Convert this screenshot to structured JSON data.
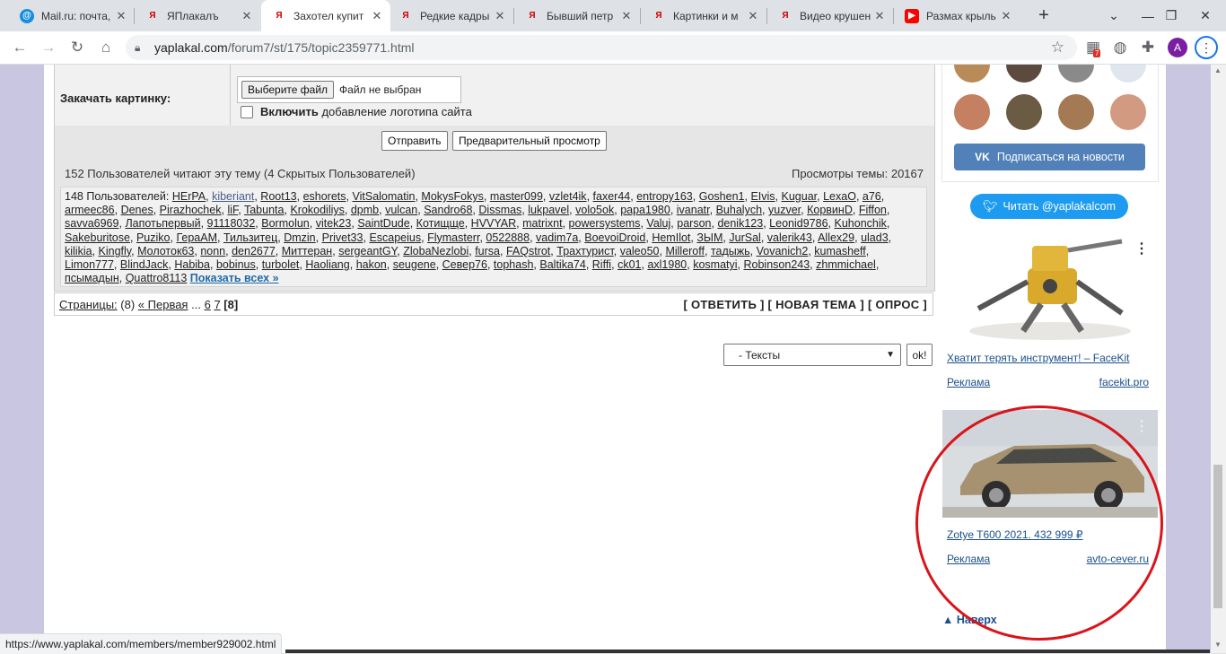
{
  "tabs": [
    {
      "title": "Mail.ru: почта,",
      "fav": "@",
      "kind": "mail"
    },
    {
      "title": "ЯПлакалъ",
      "fav": "Я",
      "kind": "yp"
    },
    {
      "title": "Захотел купит",
      "fav": "Я",
      "kind": "yp",
      "active": true
    },
    {
      "title": "Редкие кадры",
      "fav": "Я",
      "kind": "yp"
    },
    {
      "title": "Бывший петр",
      "fav": "Я",
      "kind": "yp"
    },
    {
      "title": "Картинки и м",
      "fav": "Я",
      "kind": "yp"
    },
    {
      "title": "Видео крушен",
      "fav": "Я",
      "kind": "yp"
    },
    {
      "title": "Размах крыль",
      "fav": "▶",
      "kind": "yt"
    }
  ],
  "toolbar": {
    "url_host": "yaplakal.com",
    "url_path": "/forum7/st/175/topic2359771.html",
    "avatar_letter": "A",
    "ext_badge": "7"
  },
  "form": {
    "upload_label": "Закачать картинку:",
    "file_button": "Выберите файл",
    "file_status": "Файл не выбран",
    "logo_bold": "Включить",
    "logo_rest": "добавление логотипа сайта",
    "submit": "Отправить",
    "preview": "Предварительный просмотр"
  },
  "readers": {
    "summary": "152 Пользователей читают эту тему (4 Скрытых Пользователей)",
    "views": "Просмотры темы: 20167",
    "users_prefix": "148 Пользователей:",
    "users": [
      "HErPA",
      "kiberiant",
      "Root13",
      "eshorets",
      "VitSalomatin",
      "MokysFokys",
      "master099",
      "vzlet4ik",
      "faxer44",
      "entropy163",
      "Goshen1",
      "EIvis",
      "Kuguar",
      "LexaO",
      "a76",
      "armeec86",
      "Denes",
      "Pirazhochek",
      "liF",
      "Tabunta",
      "Krokodiliys",
      "dpmb",
      "vulcan",
      "Sandro68",
      "Dissmas",
      "lukpavel",
      "volo5ok",
      "papa1980",
      "ivanatr",
      "Buhalych",
      "yuzver",
      "КорвинD",
      "Fiffon",
      "savva6969",
      "Лапотьпервый",
      "91118032",
      "Bormolun",
      "vitek23",
      "SaintDude",
      "Котищще",
      "HVVYAR",
      "matrixnt",
      "powersystems",
      "Valuj",
      "parson",
      "denik123",
      "Leonid9786",
      "Kuhonchik",
      "Sakeburitose",
      "Puziko",
      "ГераАМ",
      "Тильзитец",
      "Dmzin",
      "Privet33",
      "Escapeius",
      "Flymasterr",
      "0522888",
      "vadim7a",
      "BoevoiDroid",
      "HemIlot",
      "ЗЫМ",
      "JurSal",
      "valerik43",
      "Allex29",
      "ulad3",
      "kilikia",
      "Kingfly",
      "Молоток63",
      "nonn",
      "den2677",
      "Миттеран",
      "sergeantGY",
      "ZlobaNezlobi",
      "fursa",
      "FAQstrot",
      "Трахтурист",
      "valeo50",
      "Milleroff",
      "тадыжь",
      "Vovanich2",
      "kumasheff",
      "Limon777",
      "BlindJack",
      "Habiba",
      "bobinus",
      "turbolet",
      "Haoliang",
      "hakon",
      "seugene",
      "Север76",
      "tophash",
      "Baltika74",
      "Riffi",
      "ck01",
      "axl1980",
      "kosmatyi",
      "Robinson243",
      "zhmmichael",
      "псымадын",
      "Quattro8113"
    ],
    "show_all": "Показать всех »"
  },
  "pages": {
    "label": "Страницы:",
    "count": "(8)",
    "first": "« Первая",
    "ellipsis": "...",
    "p6": "6",
    "p7": "7",
    "current": "[8]",
    "actions": "[ ОТВЕТИТЬ ] [ НОВАЯ ТЕМА ] [ ОПРОС ]"
  },
  "section_select": {
    "value": "- Тексты",
    "ok": "ok!"
  },
  "sidebar": {
    "vk_button": "Подписаться на новости",
    "twitter_button": "Читать @yaplakalcom",
    "ads": [
      {
        "title": "Хватит терять инструмент! – FaceKit",
        "label": "Реклама",
        "domain": "facekit.pro"
      },
      {
        "title": "Zotye T600 2021. 432 999 ₽",
        "label": "Реклама",
        "domain": "avto-cever.ru"
      }
    ],
    "to_top": "▲ Наверх"
  },
  "status_url": "https://www.yaplakal.com/members/member929002.html"
}
